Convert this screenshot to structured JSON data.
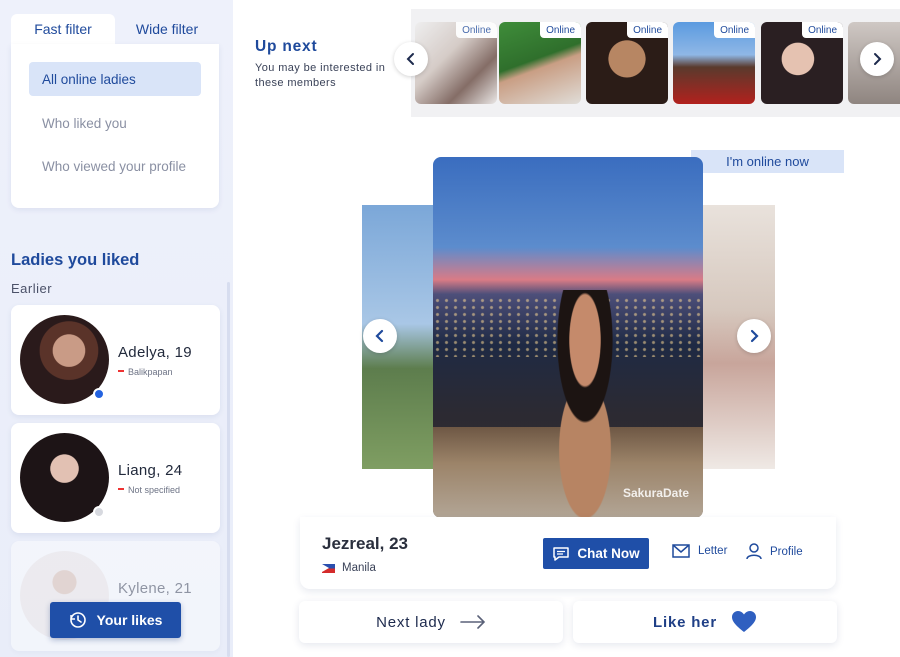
{
  "sidebar": {
    "tabs": [
      {
        "label": "Fast filter",
        "active": true
      },
      {
        "label": "Wide filter",
        "active": false
      }
    ],
    "filters": [
      {
        "label": "All online ladies",
        "active": true
      },
      {
        "label": "Who liked you",
        "active": false
      },
      {
        "label": "Who viewed your profile",
        "active": false
      }
    ],
    "liked_title": "Ladies you liked",
    "liked_section": "Earlier",
    "liked": [
      {
        "name": "Adelya, 19",
        "location": "Balikpapan",
        "online": true
      },
      {
        "name": "Liang, 24",
        "location": "Not specified",
        "online": false
      },
      {
        "name": "Kylene, 21",
        "location": "",
        "online": false
      }
    ],
    "your_likes_label": "Your likes"
  },
  "upnext": {
    "title": "Up next",
    "subtitle": "You may be interested in these members",
    "badge": "Online"
  },
  "profile": {
    "online_label": "I'm online now",
    "name": "Jezreal, 23",
    "city": "Manila",
    "watermark": "SakuraDate",
    "chat_label": "Chat Now",
    "letter_label": "Letter",
    "profile_label": "Profile"
  },
  "actions": {
    "next_label": "Next lady",
    "like_label": "Like her"
  },
  "colors": {
    "brand": "#1f4fa8",
    "accent_light": "#d9e4f8",
    "online": "#2463e0",
    "heart": "#2f5fc0"
  }
}
